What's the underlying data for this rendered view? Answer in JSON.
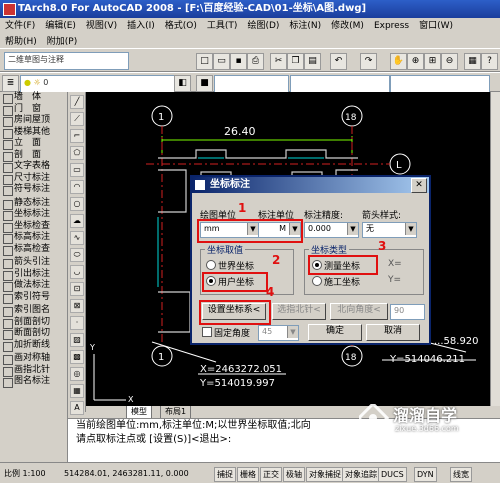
{
  "window": {
    "title": "TArch8.0 For AutoCAD 2008 - [F:\\百度经验-CAD\\01-坐标\\A图.dwg]"
  },
  "menu": {
    "row1": [
      "文件(F)",
      "编辑(E)",
      "视图(V)",
      "插入(I)",
      "格式(O)",
      "工具(T)",
      "绘图(D)",
      "标注(N)",
      "修改(M)",
      "Express",
      "窗口(W)"
    ],
    "row2": [
      "帮助(H)",
      "附加(P)"
    ]
  },
  "toolbar": {
    "layer_combo": "二维草图与注释",
    "layer_value": "0"
  },
  "sidebar": {
    "groups": [
      [
        "墙　体",
        "门　窗",
        "房间屋顶",
        "楼梯其他",
        "立　面",
        "剖　面",
        "文字表格",
        "尺寸标注",
        "符号标注"
      ],
      [
        "静态标注",
        "坐标标注",
        "坐标检查",
        "标高标注",
        "标高检查"
      ],
      [
        "箭头引注",
        "引出标注",
        "做法标注",
        "索引符号"
      ],
      [
        "索引图名",
        "剖面剖切",
        "断面剖切",
        "加折断线"
      ],
      [
        "画对称轴",
        "画指北针",
        "图名标注"
      ]
    ]
  },
  "drawing": {
    "dimension": "26.40",
    "axis_tags": [
      "1",
      "18",
      "L"
    ],
    "coord_left_x": "X=2463272.051",
    "coord_left_y": "Y=514019.997",
    "coord_right_x": "...58.920",
    "coord_right_y": "Y=514046.211"
  },
  "layout_tabs": [
    "模型",
    "布局1"
  ],
  "command_lines": [
    "当前绘图单位:mm,标注单位:M;以世界坐标取值;北向",
    "请点取标注点或 [设置(S)]<退出>:"
  ],
  "status": {
    "scale": "比例 1:100",
    "coords": "514284.01, 2463281.11, 0.000",
    "buttons": [
      "捕捉",
      "栅格",
      "正交",
      "极轴",
      "对象捕捉",
      "对象追踪",
      "DUCS",
      "DYN",
      "线宽"
    ]
  },
  "dialog": {
    "title": "坐标标注",
    "draw_unit_label": "绘图单位",
    "draw_unit_value": "mm",
    "dim_unit_label": "标注单位",
    "dim_unit_value": "M",
    "precision_label": "标注精度:",
    "precision_value": "0.000",
    "arrow_label": "箭头样式:",
    "arrow_value": "无",
    "coord_source_group": "坐标取值",
    "world_coord": "世界坐标",
    "user_coord": "用户坐标",
    "coord_type_group": "坐标类型",
    "measure_coord": "测量坐标",
    "construct_coord": "施工坐标",
    "axis_x": "X=",
    "axis_y": "Y=",
    "set_coord_button": "设置坐标系<",
    "pick_north_button": "选指北针<",
    "north_angle_button": "北向角度<",
    "north_angle_value": "90",
    "fixed_angle_label": "固定角度",
    "fixed_angle_value": "45",
    "ok": "确定",
    "cancel": "取消"
  },
  "callouts": [
    "1",
    "2",
    "3",
    "4"
  ],
  "watermark": {
    "name": "溜溜自学",
    "url": "zixue.3d66.com"
  },
  "colors": {
    "annotation_red": "#e01010",
    "titlebar_blue": "#0a246a",
    "cad_cyan": "#00d8d8",
    "cad_red": "#d02020",
    "dim_green": "#7cfc00"
  }
}
